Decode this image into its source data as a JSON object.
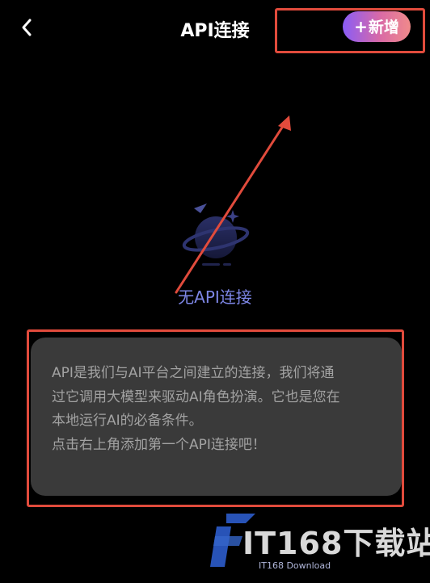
{
  "header": {
    "back_icon": "chevron-left-icon",
    "title": "API连接",
    "add_button_label": "新增",
    "add_button_icon": "plus-icon"
  },
  "empty_state": {
    "icon": "planet-icon",
    "text": "无API连接"
  },
  "info_card": {
    "lines": [
      "API是我们与AI平台之间建立的连接，我们将通",
      "过它调用大模型来驱动AI角色扮演。它也是您在",
      "本地运行AI的必备条件。",
      "点击右上角添加第一个API连接吧！"
    ]
  },
  "watermark": {
    "title": "IT168下载站",
    "subtitle": "IT168 Download"
  },
  "colors": {
    "background": "#000000",
    "accent_gradient_start": "#8a5cf6",
    "accent_gradient_end": "#f08a8a",
    "empty_text": "#7d86e6",
    "card_bg": "#3a3a3a",
    "card_text": "#a2a2a2",
    "annotation_red": "#e14b3c"
  }
}
